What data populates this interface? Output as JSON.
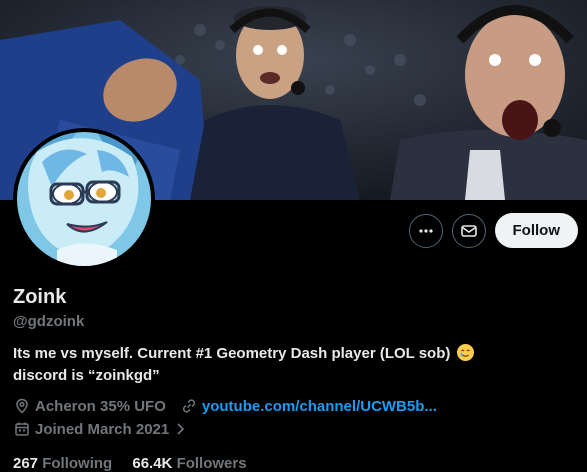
{
  "profile": {
    "display_name": "Zoink",
    "handle": "@gdzoink",
    "bio_line1": "Its me vs myself. Current #1 Geometry Dash player (LOL sob)",
    "bio_line2": "discord is “zoinkgd”",
    "location": "Acheron 35% UFO",
    "website": "youtube.com/channel/UCWB5b...",
    "joined": "Joined March 2021",
    "following_count": "267",
    "following_label": "Following",
    "followers_count": "66.4K",
    "followers_label": "Followers"
  },
  "actions": {
    "more_icon": "more-horizontal-icon",
    "message_icon": "mail-icon",
    "follow_label": "Follow"
  },
  "colors": {
    "background": "#000000",
    "text_primary": "#e7e9ea",
    "text_secondary": "#71767b",
    "link": "#1d9bf0",
    "follow_button_bg": "#eff3f4"
  }
}
